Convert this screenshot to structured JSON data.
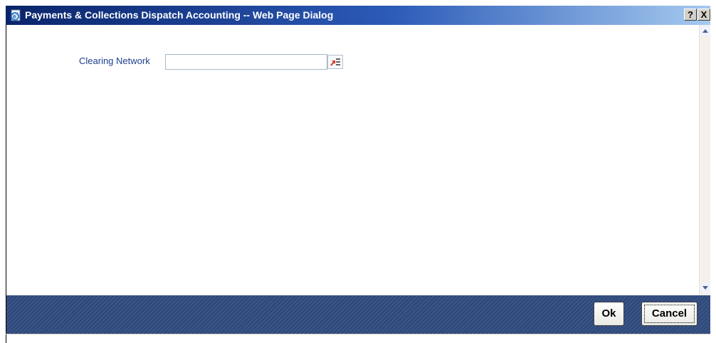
{
  "window": {
    "title": "Payments & Collections Dispatch Accounting -- Web Page Dialog",
    "help_label": "?",
    "close_label": "X"
  },
  "form": {
    "clearing_network": {
      "label": "Clearing Network",
      "value": "",
      "placeholder": ""
    },
    "lov_icon": "list-of-values-icon"
  },
  "footer": {
    "ok_label": "Ok",
    "cancel_label": "Cancel"
  },
  "colors": {
    "title_bar_start": "#0a246a",
    "title_bar_end": "#a6caf0",
    "label_color": "#1f3f8c",
    "footer_background": "#2f4a7d"
  }
}
